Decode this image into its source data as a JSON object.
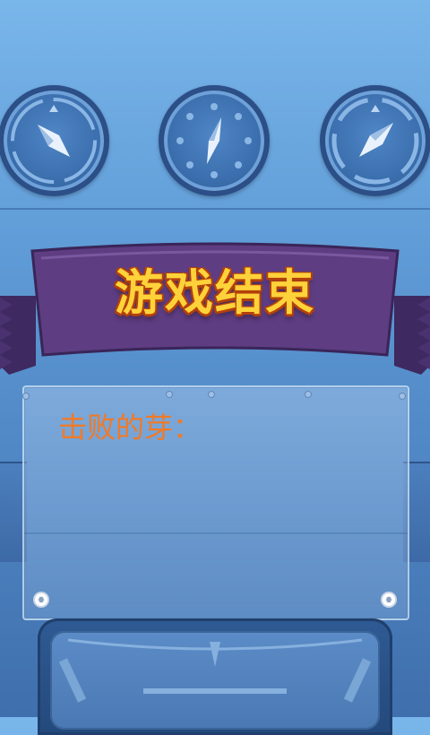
{
  "title": "游戏结束",
  "result": {
    "defeated_label": "击败的芽："
  },
  "gauges": [
    {
      "icon": "compass-gauge-icon"
    },
    {
      "icon": "compass-gauge-icon"
    },
    {
      "icon": "compass-gauge-icon"
    }
  ],
  "colors": {
    "title": "#ffd23a",
    "title_outline": "#b2410b",
    "ribbon": "#5e3d82",
    "label": "#f07a28",
    "background_top": "#79b6ea",
    "background_bottom": "#3f6fac"
  }
}
